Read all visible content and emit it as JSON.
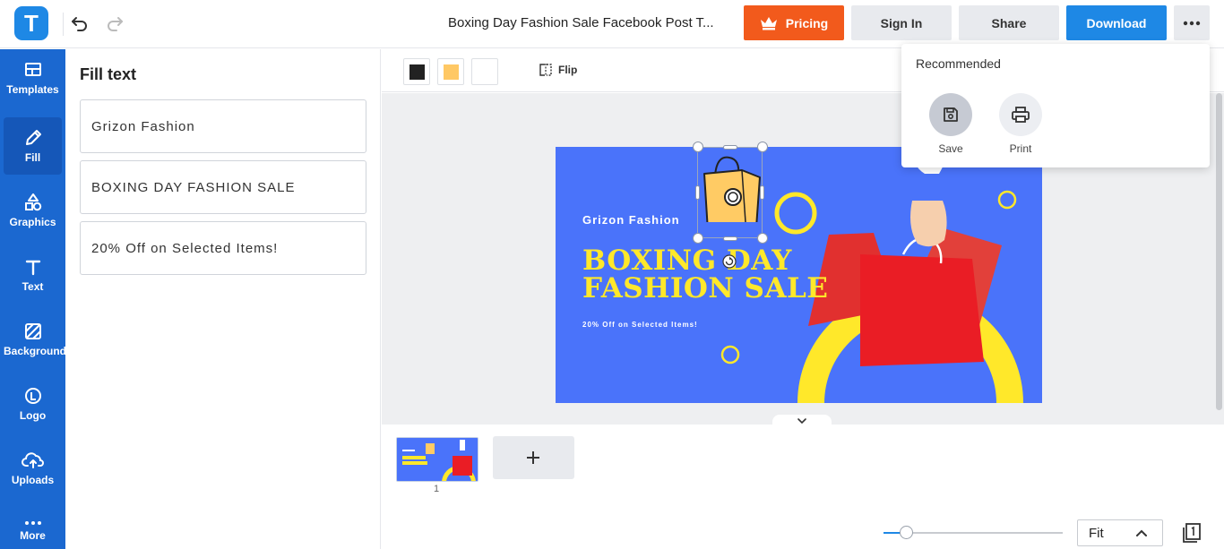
{
  "app": {
    "logo_letter": "T"
  },
  "header": {
    "doc_title": "Boxing Day Fashion Sale Facebook Post T...",
    "pricing_label": "Pricing",
    "signin_label": "Sign In",
    "share_label": "Share",
    "download_label": "Download"
  },
  "sidebar": {
    "items": [
      {
        "label": "Templates",
        "icon": "templates-icon"
      },
      {
        "label": "Fill",
        "icon": "pencil-icon",
        "active": true
      },
      {
        "label": "Graphics",
        "icon": "shapes-icon"
      },
      {
        "label": "Text",
        "icon": "text-icon"
      },
      {
        "label": "Background",
        "icon": "background-icon"
      },
      {
        "label": "Logo",
        "icon": "logo-icon"
      },
      {
        "label": "Uploads",
        "icon": "upload-cloud-icon"
      },
      {
        "label": "More",
        "icon": "more-dots-icon"
      }
    ]
  },
  "panel": {
    "title": "Fill text",
    "fields": [
      "Grizon Fashion",
      "BOXING DAY FASHION SALE",
      "20% Off on Selected Items!"
    ]
  },
  "toolbar": {
    "colors": [
      "#222222",
      "#ffc864",
      "#ffffff"
    ],
    "flip_label": "Flip"
  },
  "design": {
    "background": "#4a73fa",
    "brand": "Grizon Fashion",
    "headline_line1": "BOXING DAY",
    "headline_line2": "FASHION SALE",
    "subtext": "20% Off on Selected Items!",
    "accent": "#ffe82a"
  },
  "pages": {
    "current_number": "1"
  },
  "zoom": {
    "label": "Fit",
    "level": 0.13
  },
  "menu": {
    "title": "Recommended",
    "items": [
      {
        "label": "Save",
        "icon": "save-icon"
      },
      {
        "label": "Print",
        "icon": "print-icon"
      }
    ]
  }
}
